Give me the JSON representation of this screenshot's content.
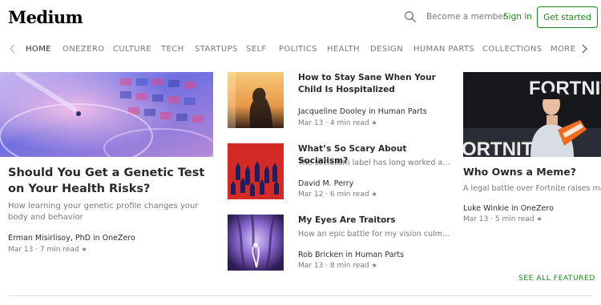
{
  "header": {
    "logo": "Medium",
    "become_member": "Become a member",
    "sign_in": "Sign in",
    "get_started": "Get started"
  },
  "nav": {
    "items": [
      "HOME",
      "ONEZERO",
      "CULTURE",
      "TECH",
      "STARTUPS",
      "SELF",
      "POLITICS",
      "HEALTH",
      "DESIGN",
      "HUMAN PARTS",
      "COLLECTIONS",
      "MORE"
    ],
    "active": "HOME"
  },
  "featured": {
    "title": "Should You Get a Genetic Test on Your Health Risks?",
    "subtitle": "How learning your genetic profile changes your body and behavior",
    "author": "Erman Misirlisoy, PhD in OneZero",
    "meta": "Mar 13 · 7 min read",
    "star": "★"
  },
  "middle": [
    {
      "title": "How to Stay Sane When Your Child Is Hospitalized",
      "subtitle": "",
      "author": "Jacqueline Dooley in Human Parts",
      "meta": "Mar 13 · 4 min read",
      "star": "★"
    },
    {
      "title": "What’s So Scary About Socialism?",
      "subtitle": "The socialism label has long worked as a political cudgel",
      "author": "David M. Perry",
      "meta": "Mar 12 · 6 min read",
      "star": "★"
    },
    {
      "title": "My Eyes Are Traitors",
      "subtitle": "How an epic battle for my vision culminated in surrender",
      "author": "Rob Bricken in Human Parts",
      "meta": "Mar 13 · 8 min read",
      "star": "★"
    }
  ],
  "right": {
    "title": "Who Owns a Meme?",
    "subtitle": "A legal battle over Fortnite raises many questions",
    "author": "Luke Winkie in OneZero",
    "meta": "Mar 13 · 5 min read",
    "star": "★",
    "image_text_1": "FORTNITE",
    "image_text_2": "ORTNITE"
  },
  "see_all": "SEE ALL FEATURED",
  "colors": {
    "accent": "#1a8917",
    "text": "rgba(0,0,0,0.84)",
    "muted": "rgba(0,0,0,0.54)"
  }
}
